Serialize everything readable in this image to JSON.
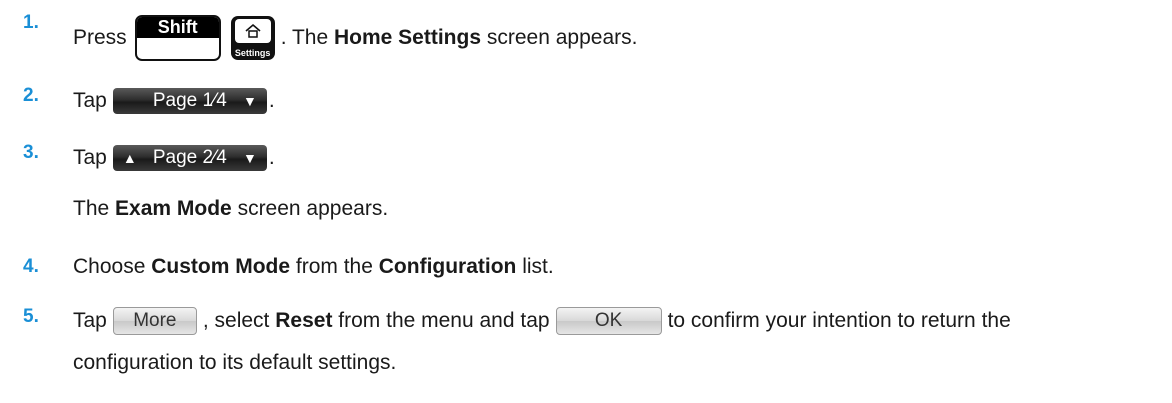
{
  "steps": [
    {
      "number": "1.",
      "press": "Press",
      "shift_key": "Shift",
      "home_key_sub": "Settings",
      "text_after": ". The ",
      "bold": "Home Settings",
      "text_end": " screen appears."
    },
    {
      "number": "2.",
      "tap": "Tap",
      "button": "Page 1⁄4",
      "end": "."
    },
    {
      "number": "3.",
      "tap": "Tap",
      "button": "Page 2⁄4",
      "end": ".",
      "follow_pre": "The ",
      "follow_bold": "Exam Mode",
      "follow_post": " screen appears."
    },
    {
      "number": "4.",
      "pre": "Choose ",
      "bold1": "Custom Mode",
      "mid": " from the ",
      "bold2": "Configuration",
      "post": " list."
    },
    {
      "number": "5.",
      "tap": "Tap",
      "more_button": "More",
      "text1": ", select ",
      "bold": "Reset",
      "text2": " from the menu and tap",
      "ok_button": "OK",
      "text3": "to confirm your intention to return the",
      "line2": "configuration to its default settings."
    }
  ],
  "colors": {
    "step_number": "#1a8fd6",
    "text": "#1a1a1a",
    "softkey": "#2e2e2e"
  },
  "icons": [
    "home-settings-icon",
    "arrow-down-icon",
    "arrow-up-icon"
  ]
}
